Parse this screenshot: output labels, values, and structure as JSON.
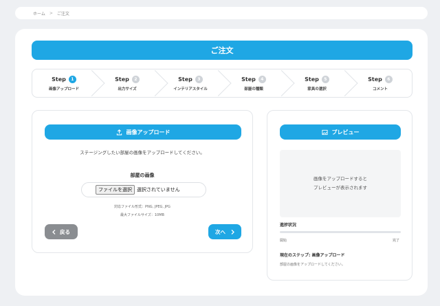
{
  "breadcrumb": {
    "home": "ホーム",
    "separator": ">",
    "current": "ご注文"
  },
  "page_title": "ご注文",
  "steps": [
    {
      "step_word": "Step",
      "num": "1",
      "label": "画像アップロード",
      "active": true
    },
    {
      "step_word": "Step",
      "num": "2",
      "label": "出力サイズ",
      "active": false
    },
    {
      "step_word": "Step",
      "num": "3",
      "label": "インテリアスタイル",
      "active": false
    },
    {
      "step_word": "Step",
      "num": "4",
      "label": "部屋の種類",
      "active": false
    },
    {
      "step_word": "Step",
      "num": "5",
      "label": "家具の選択",
      "active": false
    },
    {
      "step_word": "Step",
      "num": "6",
      "label": "コメント",
      "active": false
    }
  ],
  "upload": {
    "title": "画像アップロード",
    "instruction": "ステージングしたい部屋の画像をアップロードしてください。",
    "field_label": "部屋の画像",
    "file_button": "ファイルを選択",
    "file_status": "選択されていません",
    "hint_formats": "対応ファイル形式：PNG, JPEG, JPG",
    "hint_size": "最大ファイルサイズ：10MB",
    "back_label": "戻る",
    "next_label": "次へ"
  },
  "preview": {
    "title": "プレビュー",
    "placeholder_line1": "画像をアップロードすると",
    "placeholder_line2": "プレビューが表示されます",
    "progress_title": "進捗状況",
    "progress_start": "開始",
    "progress_end": "完了",
    "progress_value": 0,
    "current_step": "現在のステップ: 画像アップロード",
    "current_desc": "部屋の画像をアップロードしてください。"
  },
  "colors": {
    "accent": "#1fa7e4",
    "gray_button": "#8a8d91",
    "background": "#eef0f3"
  },
  "icons": {
    "upload": "upload-icon",
    "preview": "image-icon",
    "back": "chevron-left-icon",
    "next": "chevron-right-icon"
  }
}
